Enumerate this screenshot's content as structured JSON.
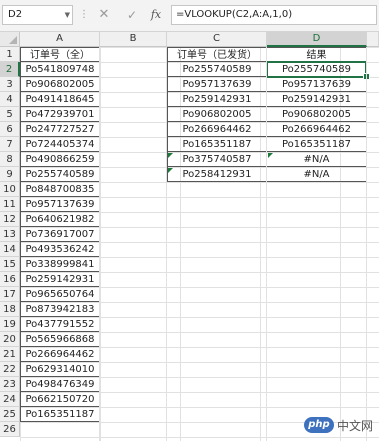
{
  "formula_bar": {
    "name_box": "D2",
    "name_box_arrow": "▼",
    "dots": "⋮",
    "cancel": "✕",
    "enter": "✓",
    "fx": "fx",
    "formula": "=VLOOKUP(C2,A:A,1,0)"
  },
  "columns": [
    "A",
    "B",
    "C",
    "D"
  ],
  "rows": [
    "1",
    "2",
    "3",
    "4",
    "5",
    "6",
    "7",
    "8",
    "9",
    "10",
    "11",
    "12",
    "13",
    "14",
    "15",
    "16",
    "17",
    "18",
    "19",
    "20",
    "21",
    "22",
    "23",
    "24",
    "25",
    "26"
  ],
  "sheet": {
    "a_header": "订单号（全）",
    "a_values": [
      "Po541809748",
      "Po906802005",
      "Po491418645",
      "Po472939701",
      "Po247727527",
      "Po724405374",
      "Po490866259",
      "Po255740589",
      "Po848700835",
      "Po957137639",
      "Po640621982",
      "Po736917007",
      "Po493536242",
      "Po338999841",
      "Po259142931",
      "Po965650764",
      "Po873942183",
      "Po437791552",
      "Po565966868",
      "Po266964462",
      "Po629314010",
      "Po498476349",
      "Po662150720",
      "Po165351187"
    ],
    "c_header": "订单号（已发货）",
    "d_header": "结果",
    "c_values": [
      "Po255740589",
      "Po957137639",
      "Po259142931",
      "Po906802005",
      "Po266964462",
      "Po165351187",
      "Po375740587",
      "Po258412931"
    ],
    "d_values": [
      "Po255740589",
      "Po957137639",
      "Po259142931",
      "Po906802005",
      "Po266964462",
      "Po165351187",
      "#N/A",
      "#N/A"
    ]
  },
  "watermark": {
    "logo_text": "php",
    "text": "中文网"
  },
  "colors": {
    "accent": "#217346",
    "error_marker": "#1b7a3a"
  }
}
